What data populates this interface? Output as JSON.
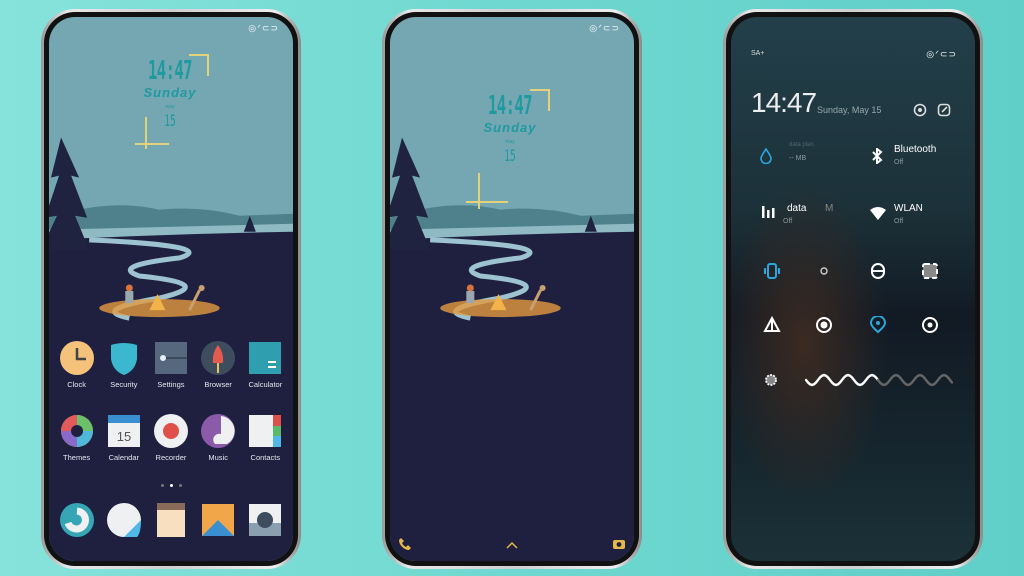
{
  "status_icons": "◎ᐟ⊂⊃",
  "lock_clock": {
    "time": "14:47",
    "day": "Sunday",
    "month": "may",
    "date": "15"
  },
  "home": {
    "apps_row1": [
      {
        "label": "Clock",
        "icon": "clock-icon"
      },
      {
        "label": "Security",
        "icon": "shield-icon"
      },
      {
        "label": "Settings",
        "icon": "settings-icon"
      },
      {
        "label": "Browser",
        "icon": "rocket-icon"
      },
      {
        "label": "Calculator",
        "icon": "calculator-icon"
      }
    ],
    "apps_row2": [
      {
        "label": "Themes",
        "icon": "themes-icon"
      },
      {
        "label": "Calendar",
        "icon": "calendar-icon",
        "badge": "15"
      },
      {
        "label": "Recorder",
        "icon": "recorder-icon"
      },
      {
        "label": "Music",
        "icon": "music-icon"
      },
      {
        "label": "Contacts",
        "icon": "contacts-icon"
      }
    ],
    "page_indicator": {
      "pages": 3,
      "current": 2
    },
    "dock": [
      "phone-icon",
      "messages-icon",
      "notes-icon",
      "gallery-icon",
      "camera-icon"
    ]
  },
  "control_center": {
    "carrier": "SA+",
    "time": "14:47",
    "date": "Sunday, May 15",
    "tiles": [
      {
        "title": "data plan",
        "sub": "-- MB",
        "icon": "drop-icon"
      },
      {
        "title": "Bluetooth",
        "sub": "Off",
        "icon": "bluetooth-icon"
      },
      {
        "title": "data",
        "extra": "M",
        "sub": "Off",
        "icon": "signal-icon"
      },
      {
        "title": "WLAN",
        "sub": "Off",
        "icon": "wifi-icon"
      }
    ],
    "toggles": [
      "vibrate-icon",
      "dnd-icon",
      "flashlight-icon",
      "screenshot-icon",
      "airplane-icon",
      "dark-mode-icon",
      "location-icon",
      "reading-mode-icon"
    ],
    "brightness_level": 0.5
  },
  "colors": {
    "accent": "#1f9aa0",
    "toggle_active": "#2aa7e0",
    "ground": "#1f2040",
    "sky": "#74a7b2"
  }
}
